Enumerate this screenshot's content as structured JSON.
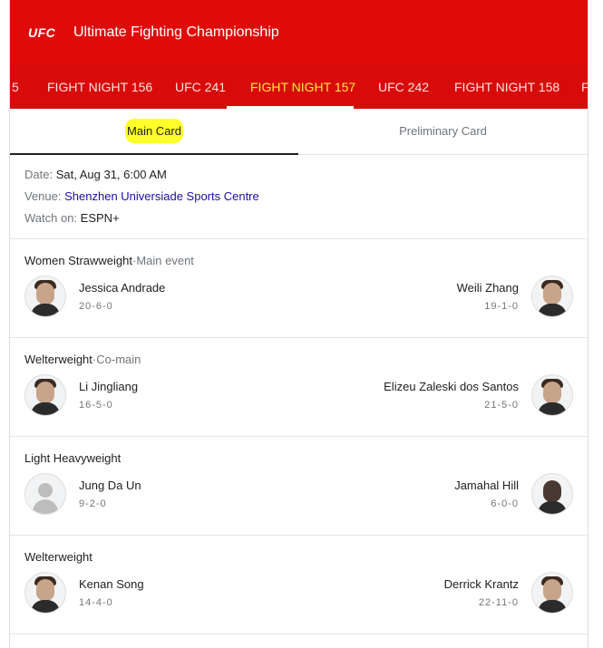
{
  "header": {
    "logo_text": "UFC",
    "title": "Ultimate Fighting Championship"
  },
  "events": {
    "tabs": [
      {
        "label": "5"
      },
      {
        "label": "FIGHT NIGHT 156"
      },
      {
        "label": "UFC 241"
      },
      {
        "label": "FIGHT NIGHT 157"
      },
      {
        "label": "UFC 242"
      },
      {
        "label": "FIGHT NIGHT 158"
      },
      {
        "label": "F"
      }
    ],
    "active_tab": "FIGHT NIGHT 157"
  },
  "card_tabs": {
    "main": "Main Card",
    "prelim": "Preliminary Card"
  },
  "event_info": {
    "date_label": "Date:",
    "date": "Sat, Aug 31, 6:00 AM",
    "venue_label": "Venue:",
    "venue": "Shenzhen Universiade Sports Centre",
    "watch_label": "Watch on:",
    "watch": "ESPN+"
  },
  "bouts": [
    {
      "division": "Women Strawweight",
      "separator": "·",
      "tag": "Main event",
      "left": {
        "name": "Jessica Andrade",
        "record": "20-6-0"
      },
      "right": {
        "name": "Weili Zhang",
        "record": "19-1-0"
      }
    },
    {
      "division": "Welterweight",
      "separator": "·",
      "tag": "Co-main",
      "left": {
        "name": "Li Jingliang",
        "record": "16-5-0"
      },
      "right": {
        "name": "Elizeu Zaleski dos Santos",
        "record": "21-5-0"
      }
    },
    {
      "division": "Light Heavyweight",
      "separator": "",
      "tag": "",
      "left": {
        "name": "Jung Da Un",
        "record": "9-2-0"
      },
      "right": {
        "name": "Jamahal Hill",
        "record": "6-0-0"
      }
    },
    {
      "division": "Welterweight",
      "separator": "",
      "tag": "",
      "left": {
        "name": "Kenan Song",
        "record": "14-4-0"
      },
      "right": {
        "name": "Derrick Krantz",
        "record": "22-11-0"
      }
    }
  ],
  "colors": {
    "brand_red": "#df0b0b",
    "active_tab": "#ffeb3b",
    "link": "#1a0dab",
    "highlight": "#ffff2a"
  }
}
